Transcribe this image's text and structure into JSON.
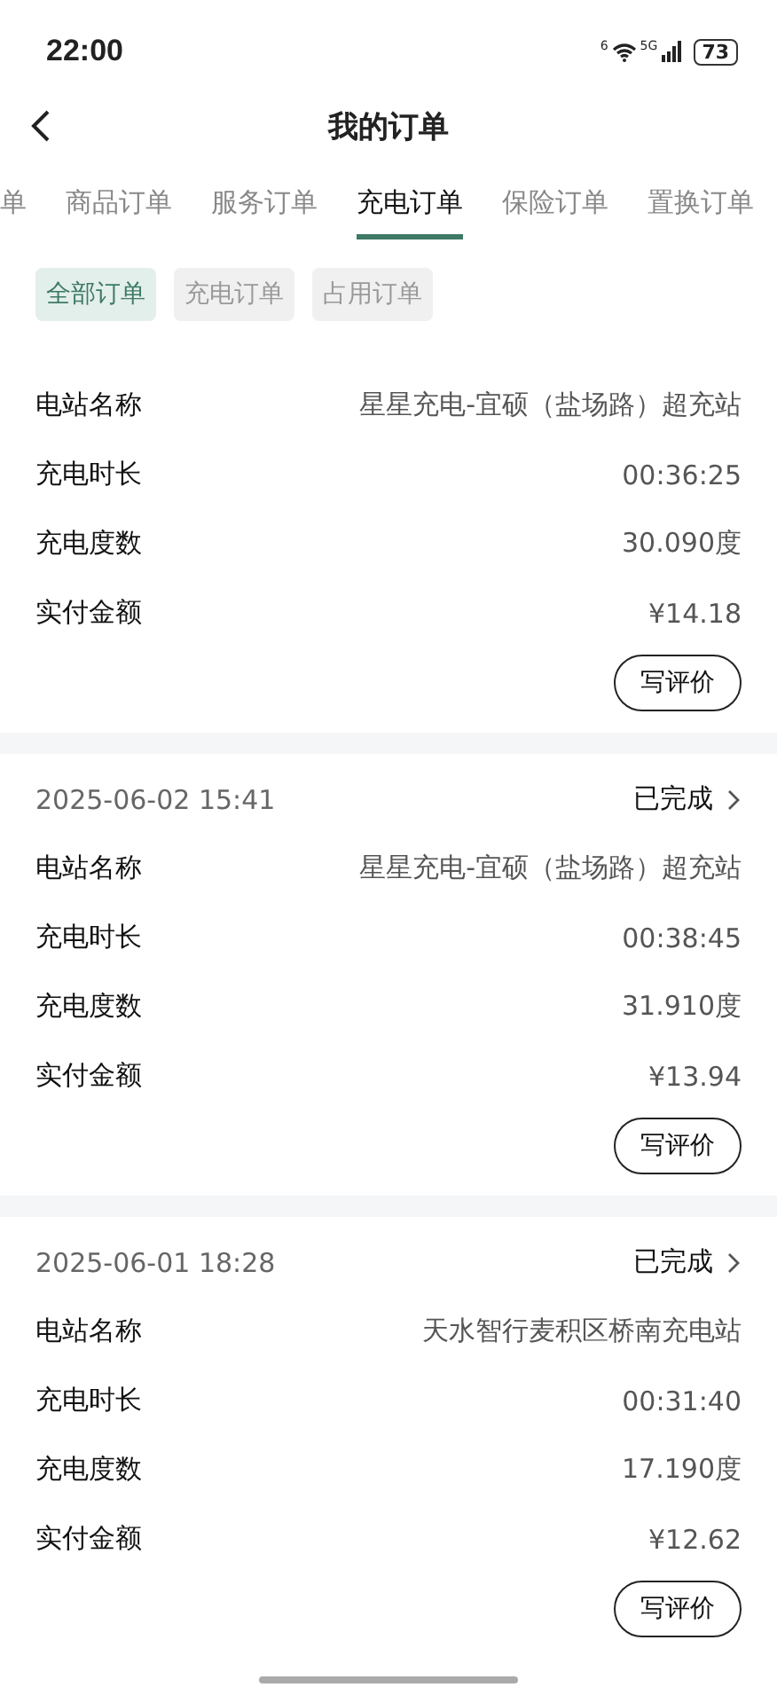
{
  "status_bar": {
    "time": "22:00",
    "wifi_label": "6",
    "network": "5G",
    "battery": "73"
  },
  "header": {
    "title": "我的订单"
  },
  "tabs": [
    {
      "label": "单",
      "selected": false
    },
    {
      "label": "商品订单",
      "selected": false
    },
    {
      "label": "服务订单",
      "selected": false
    },
    {
      "label": "充电订单",
      "selected": true
    },
    {
      "label": "保险订单",
      "selected": false
    },
    {
      "label": "置换订单",
      "selected": false
    }
  ],
  "filters": [
    {
      "label": "全部订单",
      "selected": true
    },
    {
      "label": "充电订单",
      "selected": false
    },
    {
      "label": "占用订单",
      "selected": false
    }
  ],
  "orders": [
    {
      "fields": [
        {
          "label": "电站名称",
          "value": "星星充电-宜硕（盐场路）超充站"
        },
        {
          "label": "充电时长",
          "value": "00:36:25"
        },
        {
          "label": "充电度数",
          "value": "30.090度"
        },
        {
          "label": "实付金额",
          "value": "¥14.18"
        }
      ],
      "button": "写评价"
    },
    {
      "date": "2025-06-02 15:41",
      "status": "已完成",
      "fields": [
        {
          "label": "电站名称",
          "value": "星星充电-宜硕（盐场路）超充站"
        },
        {
          "label": "充电时长",
          "value": "00:38:45"
        },
        {
          "label": "充电度数",
          "value": "31.910度"
        },
        {
          "label": "实付金额",
          "value": "¥13.94"
        }
      ],
      "button": "写评价"
    },
    {
      "date": "2025-06-01 18:28",
      "status": "已完成",
      "fields": [
        {
          "label": "电站名称",
          "value": "天水智行麦积区桥南充电站"
        },
        {
          "label": "充电时长",
          "value": "00:31:40"
        },
        {
          "label": "充电度数",
          "value": "17.190度"
        },
        {
          "label": "实付金额",
          "value": "¥12.62"
        }
      ],
      "button": "写评价"
    }
  ]
}
